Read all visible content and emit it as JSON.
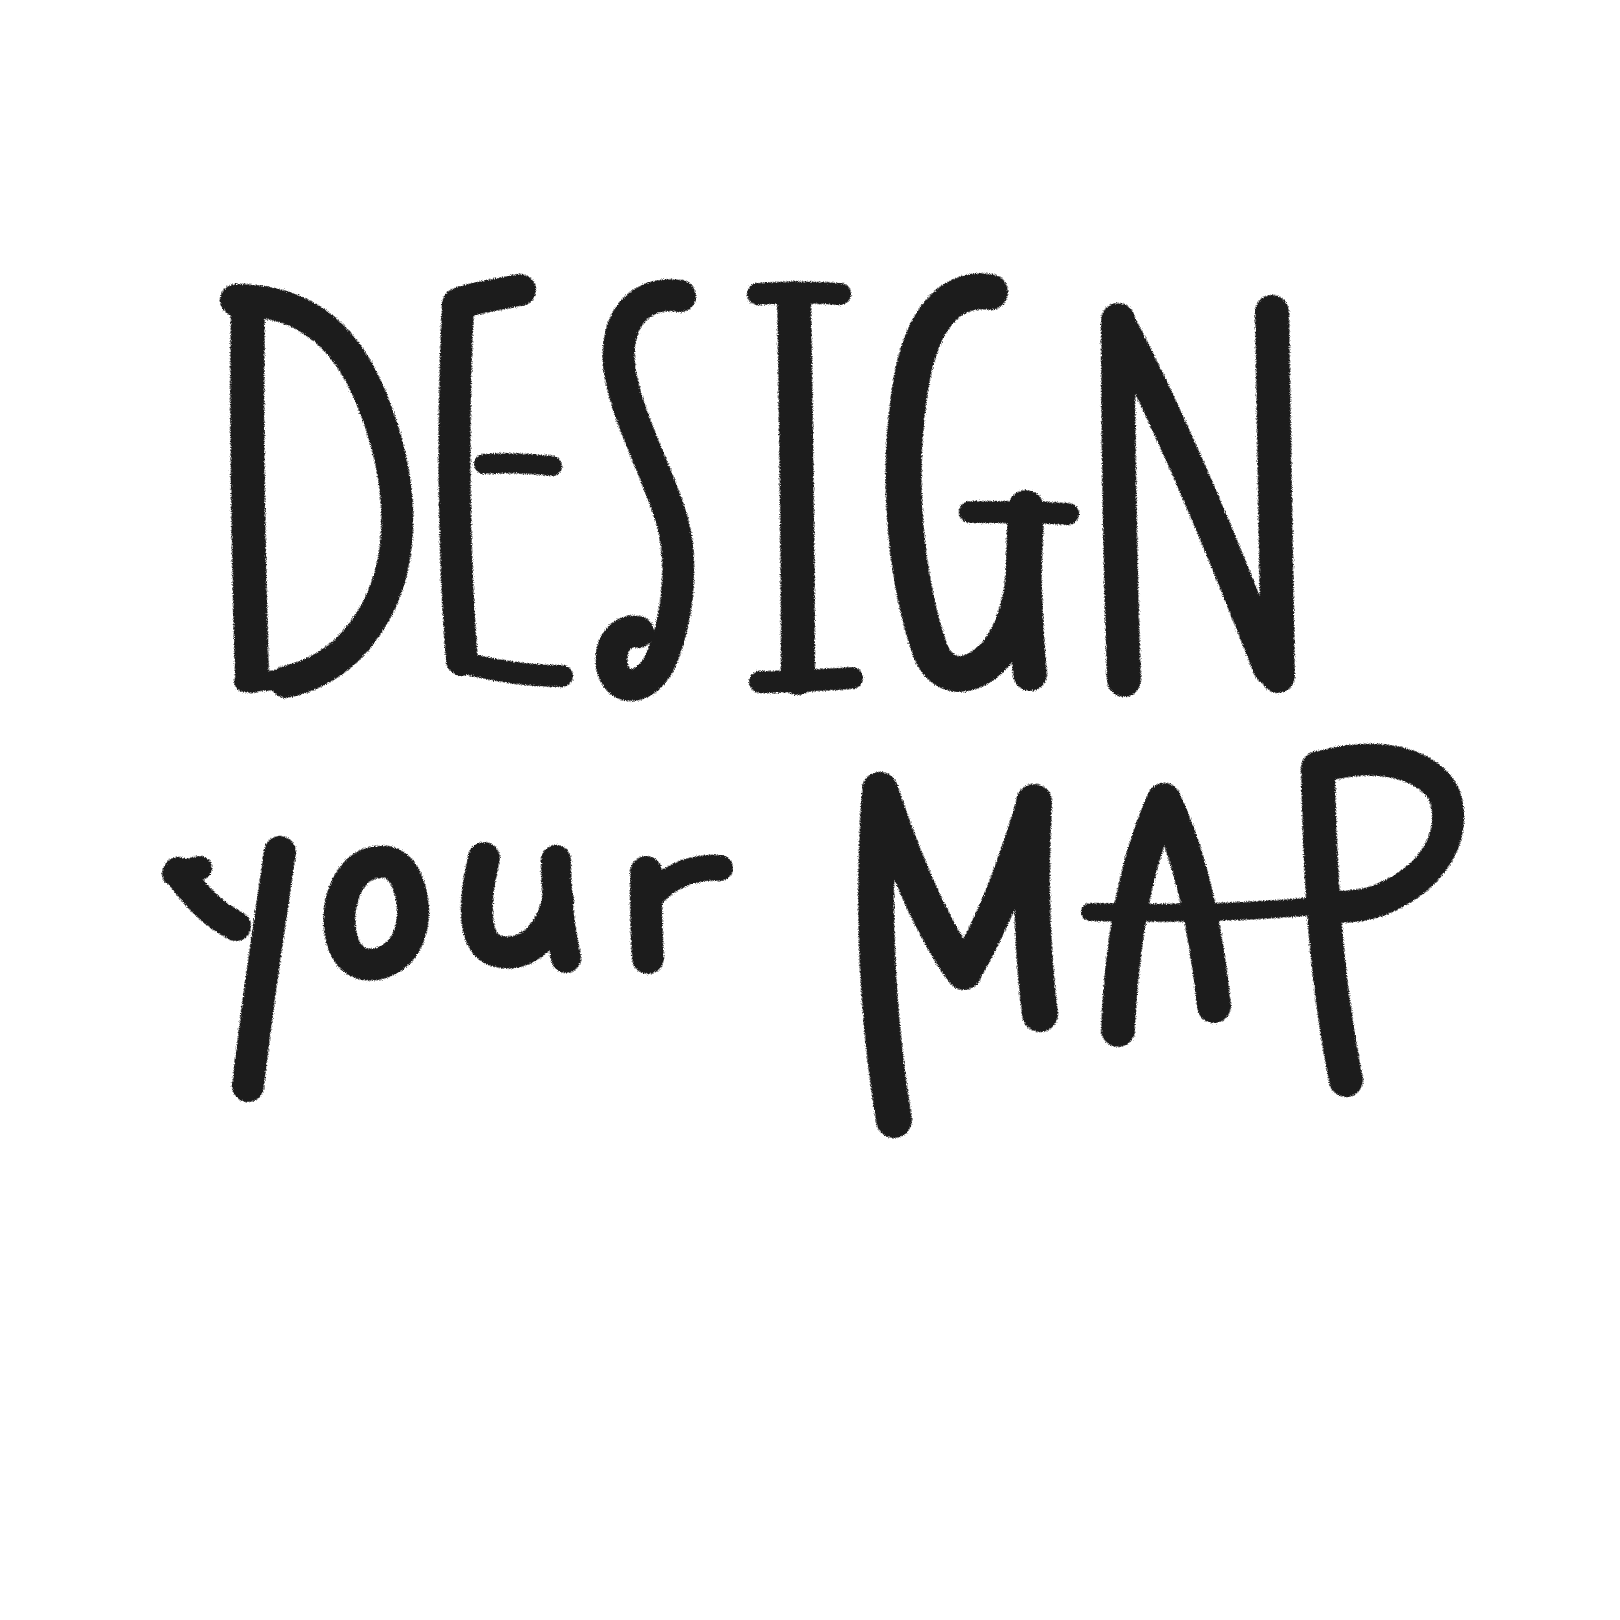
{
  "artwork": {
    "line1": "DESIGN",
    "line2_word1": "your",
    "line2_word2": "MAP"
  },
  "colors": {
    "background": "#ffffff",
    "ink": "#1b1b1b"
  }
}
